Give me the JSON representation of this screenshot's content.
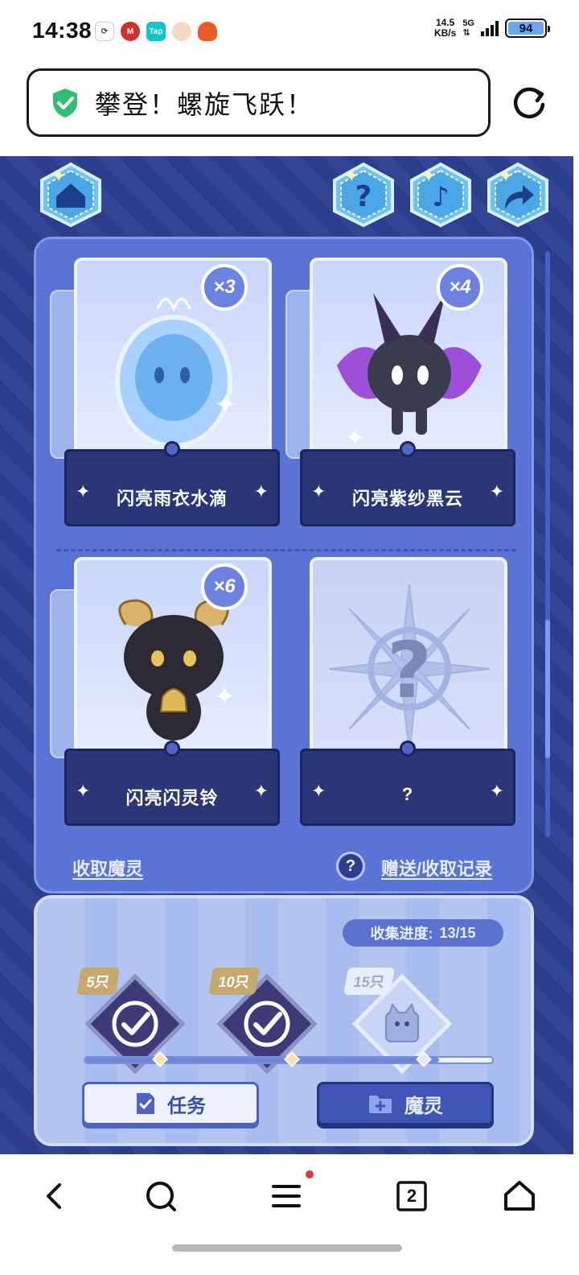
{
  "status_bar": {
    "time": "14:38",
    "net_speed_value": "14.5",
    "net_speed_unit": "KB/s",
    "network": "5G",
    "battery": "94",
    "app_icons": [
      "sync-app-icon",
      "china-merchants-bank-icon",
      "taptap-icon",
      "avatar-app-icon",
      "game-app-icon"
    ]
  },
  "browser": {
    "page_title": "攀登！螺旋飞跃！",
    "secure_icon": "shield-check-icon",
    "reload_icon": "reload-icon"
  },
  "game": {
    "top_buttons": [
      "home-icon",
      "help-icon",
      "music-icon",
      "share-icon"
    ],
    "cards": [
      {
        "name": "闪亮雨衣水滴",
        "count": "×3",
        "revealed": true
      },
      {
        "name": "闪亮紫纱黑云",
        "count": "×4",
        "revealed": true
      },
      {
        "name": "闪亮闪灵铃",
        "count": "×6",
        "revealed": true
      },
      {
        "name": "?",
        "count": "",
        "revealed": false
      }
    ],
    "collect_link": "收取魔灵",
    "help_glyph": "?",
    "records_link": "赠送/收取记录",
    "progress": {
      "label": "收集进度:",
      "value": "13/15",
      "fraction": 0.87,
      "milestones": [
        {
          "tag": "5只",
          "done": true
        },
        {
          "tag": "10只",
          "done": true
        },
        {
          "tag": "15只",
          "done": false
        }
      ]
    },
    "buttons": {
      "task": "任务",
      "sprite": "魔灵"
    }
  },
  "nav": {
    "tabs_count": "2",
    "items": [
      "back-icon",
      "search-icon",
      "menu-icon",
      "tabs-icon",
      "home-icon"
    ]
  },
  "colors": {
    "game_bg": "#2e3f91",
    "panel": "#5a74d6",
    "accent_green": "#2fbf71"
  }
}
